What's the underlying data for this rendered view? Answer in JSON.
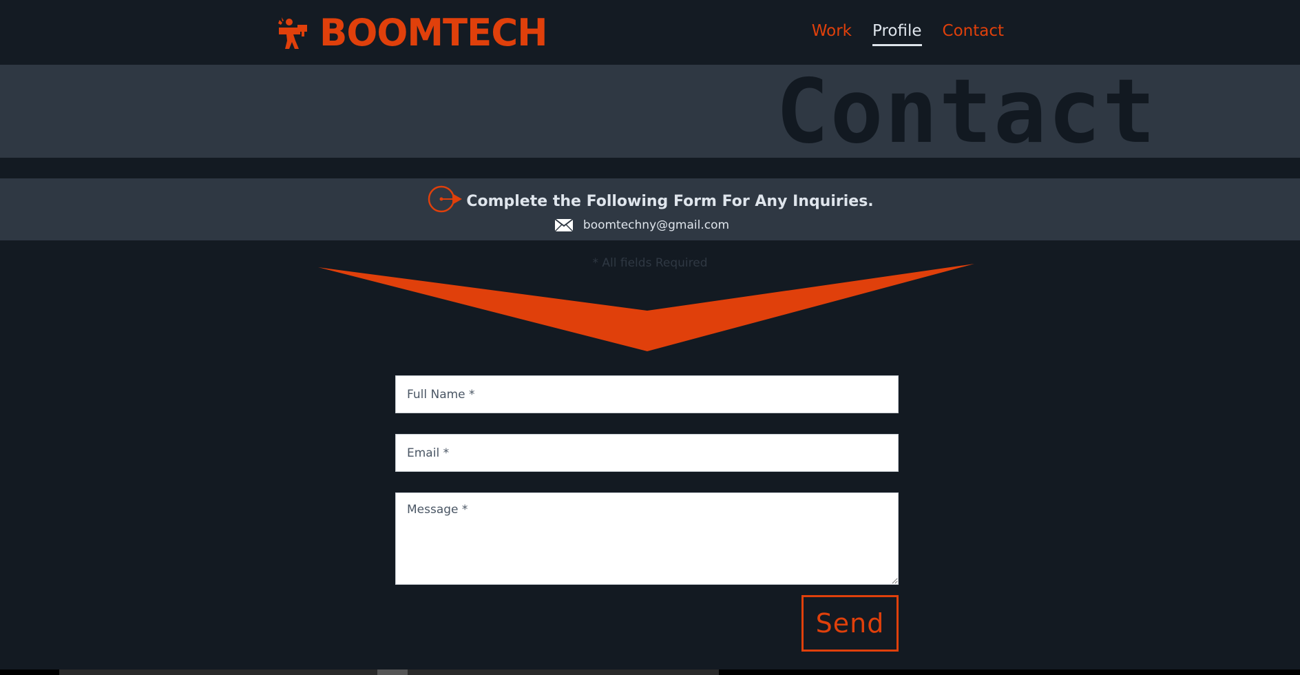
{
  "brand": {
    "name": "BOOMTECH",
    "logo_icon": "soldier-with-bazooka-icon"
  },
  "nav": [
    {
      "label": "Work",
      "active": false
    },
    {
      "label": "Profile",
      "active": true
    },
    {
      "label": "Contact",
      "active": false
    }
  ],
  "hero": {
    "title": "Contact"
  },
  "info": {
    "heading": "Complete the Following Form For Any Inquiries.",
    "email": "boomtechny@gmail.com"
  },
  "form": {
    "required_note": "* All fields Required",
    "name_placeholder": "Full Name *",
    "email_placeholder": "Email *",
    "message_placeholder": "Message *",
    "send_label": "Send"
  },
  "colors": {
    "accent": "#e0400b",
    "background": "#131a22",
    "panel": "#2f3843",
    "text": "#dfe5ec"
  }
}
